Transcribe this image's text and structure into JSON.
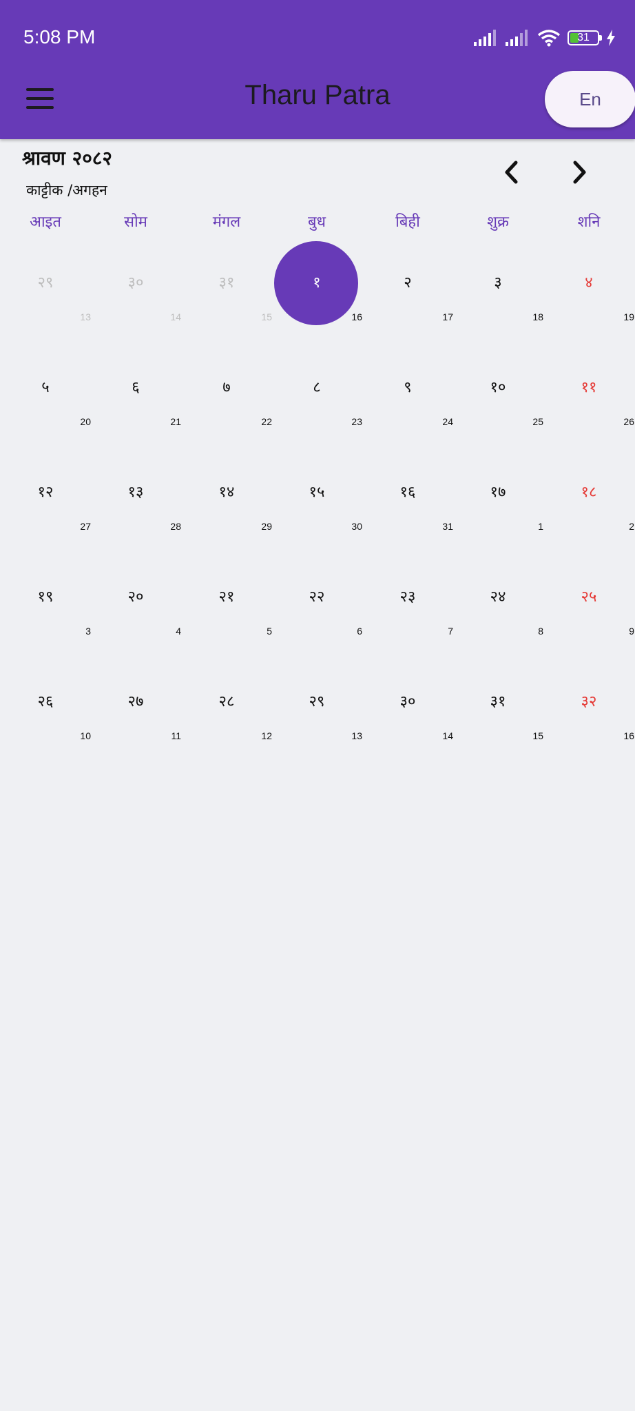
{
  "status_bar": {
    "time": "5:08 PM",
    "battery": "31",
    "battery_level_percent": 31,
    "icons": [
      "signal-icon",
      "signal-icon",
      "wifi-icon",
      "battery-icon",
      "charging-icon"
    ]
  },
  "app_bar": {
    "title": "Tharu Patra",
    "language_button": "En",
    "menu_icon": "hamburger-menu-icon"
  },
  "calendar": {
    "month_title": "श्रावण २०८२",
    "month_subtitle": "काट्टीक /अगहन",
    "weekdays": [
      "आइत",
      "सोम",
      "मंगल",
      "बुध",
      "बिही",
      "शुक्र",
      "शनि"
    ],
    "weeks": [
      [
        {
          "nep": "२९",
          "eng": "13",
          "muted": true
        },
        {
          "nep": "३०",
          "eng": "14",
          "muted": true
        },
        {
          "nep": "३१",
          "eng": "15",
          "muted": true
        },
        {
          "nep": "१",
          "eng": "16",
          "selected": true
        },
        {
          "nep": "२",
          "eng": "17"
        },
        {
          "nep": "३",
          "eng": "18"
        },
        {
          "nep": "४",
          "eng": "19"
        }
      ],
      [
        {
          "nep": "५",
          "eng": "20"
        },
        {
          "nep": "६",
          "eng": "21"
        },
        {
          "nep": "७",
          "eng": "22"
        },
        {
          "nep": "८",
          "eng": "23"
        },
        {
          "nep": "९",
          "eng": "24"
        },
        {
          "nep": "१०",
          "eng": "25"
        },
        {
          "nep": "११",
          "eng": "26"
        }
      ],
      [
        {
          "nep": "१२",
          "eng": "27"
        },
        {
          "nep": "१३",
          "eng": "28"
        },
        {
          "nep": "१४",
          "eng": "29"
        },
        {
          "nep": "१५",
          "eng": "30"
        },
        {
          "nep": "१६",
          "eng": "31"
        },
        {
          "nep": "१७",
          "eng": "1"
        },
        {
          "nep": "१८",
          "eng": "2"
        }
      ],
      [
        {
          "nep": "१९",
          "eng": "3"
        },
        {
          "nep": "२०",
          "eng": "4"
        },
        {
          "nep": "२१",
          "eng": "5"
        },
        {
          "nep": "२२",
          "eng": "6"
        },
        {
          "nep": "२३",
          "eng": "7"
        },
        {
          "nep": "२४",
          "eng": "8"
        },
        {
          "nep": "२५",
          "eng": "9"
        }
      ],
      [
        {
          "nep": "२६",
          "eng": "10"
        },
        {
          "nep": "२७",
          "eng": "11"
        },
        {
          "nep": "२८",
          "eng": "12"
        },
        {
          "nep": "२९",
          "eng": "13"
        },
        {
          "nep": "३०",
          "eng": "14"
        },
        {
          "nep": "३१",
          "eng": "15"
        },
        {
          "nep": "३२",
          "eng": "16"
        }
      ]
    ]
  },
  "colors": {
    "primary": "#673ab7",
    "saturday": "#e53935",
    "muted": "#bdbdbd",
    "background": "#eff0f3"
  }
}
